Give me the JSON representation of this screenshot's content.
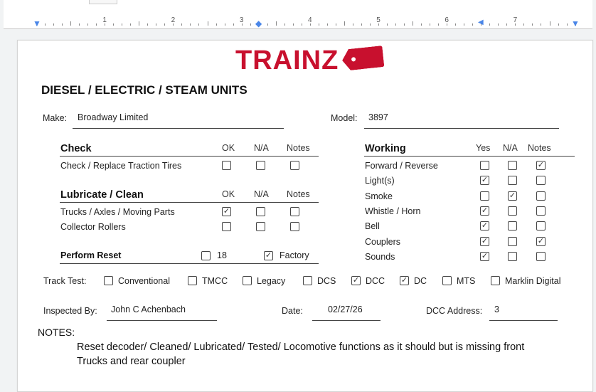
{
  "ruler": {
    "numbers": [
      "1",
      "2",
      "3",
      "4",
      "5",
      "6",
      "7"
    ]
  },
  "logo": {
    "text": "TRAINZ"
  },
  "form": {
    "title": "DIESEL / ELECTRIC / STEAM UNITS",
    "make_label": "Make:",
    "make_value": "Broadway Limited",
    "model_label": "Model:",
    "model_value": "3897",
    "check": {
      "heading": "Check",
      "cols": [
        "OK",
        "N/A",
        "Notes"
      ],
      "rows": [
        {
          "label": "Check / Replace Traction Tires",
          "values": [
            false,
            false,
            false
          ]
        }
      ]
    },
    "lubricate": {
      "heading": "Lubricate / Clean",
      "cols": [
        "OK",
        "N/A",
        "Notes"
      ],
      "rows": [
        {
          "label": "Trucks / Axles / Moving Parts",
          "values": [
            true,
            false,
            false
          ]
        },
        {
          "label": "Collector Rollers",
          "values": [
            false,
            false,
            false
          ]
        }
      ]
    },
    "reset": {
      "label": "Perform Reset",
      "opt1": "18",
      "opt1_checked": false,
      "opt2": "Factory",
      "opt2_checked": true
    },
    "working": {
      "heading": "Working",
      "cols": [
        "Yes",
        "N/A",
        "Notes"
      ],
      "rows": [
        {
          "label": "Forward / Reverse",
          "values": [
            false,
            false,
            true
          ]
        },
        {
          "label": "Light(s)",
          "values": [
            true,
            false,
            false
          ]
        },
        {
          "label": "Smoke",
          "values": [
            false,
            true,
            false
          ]
        },
        {
          "label": "Whistle / Horn",
          "values": [
            true,
            false,
            false
          ]
        },
        {
          "label": "Bell",
          "values": [
            true,
            false,
            false
          ]
        },
        {
          "label": "Couplers",
          "values": [
            true,
            false,
            true
          ]
        },
        {
          "label": "Sounds",
          "values": [
            true,
            false,
            false
          ]
        }
      ]
    },
    "track_test": {
      "label": "Track Test:",
      "options": [
        {
          "label": "Conventional",
          "checked": false
        },
        {
          "label": "TMCC",
          "checked": false
        },
        {
          "label": "Legacy",
          "checked": false
        },
        {
          "label": "DCS",
          "checked": false
        },
        {
          "label": "DCC",
          "checked": true
        },
        {
          "label": "DC",
          "checked": true
        },
        {
          "label": "MTS",
          "checked": false
        },
        {
          "label": "Marklin Digital",
          "checked": false
        }
      ]
    },
    "inspected_label": "Inspected By:",
    "inspected_value": "John C Achenbach",
    "date_label": "Date:",
    "date_value": "02/27/26",
    "dcc_label": "DCC Address:",
    "dcc_value": "3",
    "notes_label": "NOTES:",
    "notes_line1": "Reset decoder/ Cleaned/ Lubricated/ Tested/  Locomotive functions as it should but is missing front",
    "notes_line2": "Trucks and rear coupler"
  }
}
